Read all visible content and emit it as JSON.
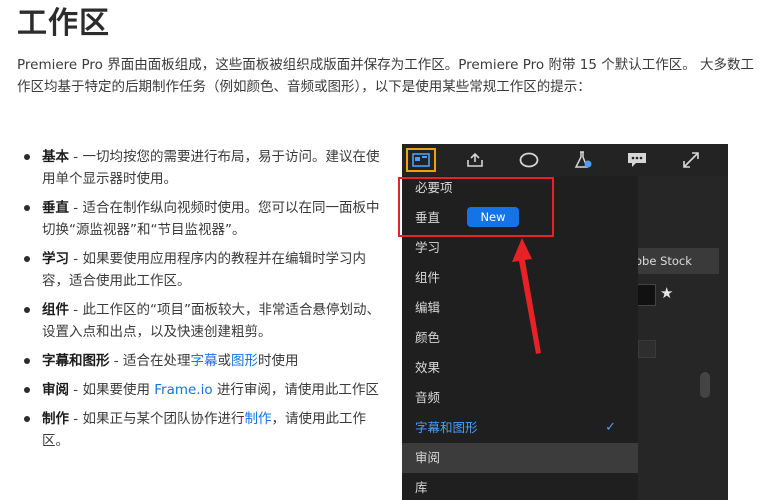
{
  "title": "工作区",
  "intro": "Premiere Pro 界面由面板组成，这些面板被组织成版面并保存为工作区。Premiere Pro 附带 15 个默认工作区。 大多数工作区均基于特定的后期制作任务（例如颜色、音频或图形），以下是使用某些常规工作区的提示：",
  "bullets": [
    {
      "term": "基本",
      "text": " - 一切均按您的需要进行布局，易于访问。建议在使用单个显示器时使用。"
    },
    {
      "term": "垂直",
      "text": " - 适合在制作纵向视频时使用。您可以在同一面板中切换“源监视器”和“节目监视器”。"
    },
    {
      "term": "学习",
      "text": " - 如果要使用应用程序内的教程并在编辑时学习内容，适合使用此工作区。"
    },
    {
      "term": "组件",
      "text": " - 此工作区的“项目”面板较大，非常适合悬停划动、设置入点和出点，以及快速创建粗剪。"
    },
    {
      "term": "字幕和图形",
      "pre": " - 适合在处理",
      "link1": "字幕",
      "mid": "或",
      "link2": "图形",
      "post": "时使用"
    },
    {
      "term": "审阅",
      "pre": " - 如果要使用 ",
      "link": "Frame.io",
      "post": " 进行审阅，请使用此工作区"
    },
    {
      "term": "制作",
      "pre": " - 如果正与某个团队协作进行",
      "link": "制作",
      "post": "，请使用此工作区。"
    }
  ],
  "panel": {
    "stock_label": "obe Stock",
    "star": "★",
    "new_badge": "New",
    "check": "✓",
    "menu": [
      {
        "label": "必要项"
      },
      {
        "label": "垂直"
      },
      {
        "label": "学习"
      },
      {
        "label": "组件"
      },
      {
        "label": "编辑"
      },
      {
        "label": "颜色"
      },
      {
        "label": "效果"
      },
      {
        "label": "音频"
      },
      {
        "label": "字幕和图形"
      },
      {
        "label": "审阅"
      },
      {
        "label": "库"
      }
    ],
    "toolbar_icons": [
      "workspaces-icon",
      "export-icon",
      "circle-icon",
      "flask-icon",
      "chat-icon",
      "expand-icon"
    ]
  },
  "colors": {
    "accent_link": "#1473e6",
    "highlight_box": "#e82127",
    "active_icon_border": "#e8a317",
    "menu_active": "#4c9ef5"
  }
}
